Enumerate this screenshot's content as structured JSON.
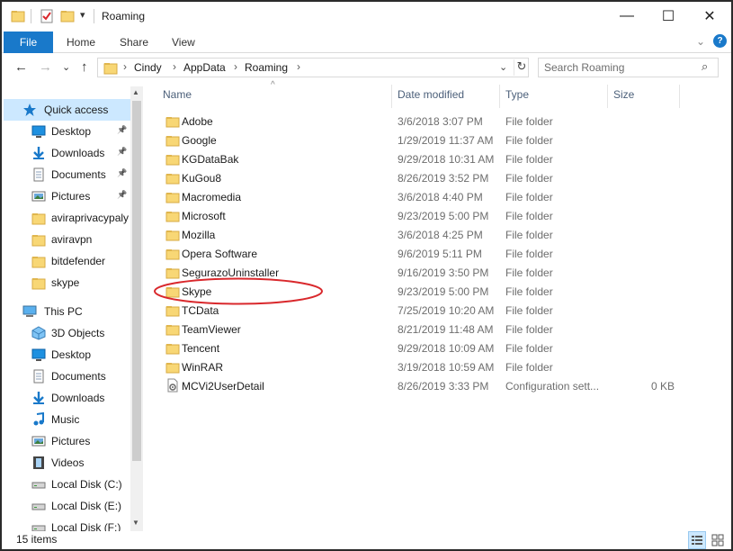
{
  "window": {
    "title": "Roaming",
    "minimize": "—",
    "maximize": "☐",
    "close": "✕"
  },
  "ribbon": {
    "tabs": [
      "File",
      "Home",
      "Share",
      "View"
    ],
    "expand_glyph": "⌄",
    "help_glyph": "?"
  },
  "nav": {
    "back": "←",
    "forward": "→",
    "recent": "⌄",
    "up": "↑",
    "breadcrumb": [
      "Cindy",
      "AppData",
      "Roaming"
    ],
    "search_placeholder": "Search Roaming"
  },
  "sidebar": {
    "items": [
      {
        "label": "Quick access",
        "icon": "star-icon",
        "pinned": false,
        "selected": true
      },
      {
        "label": "Desktop",
        "icon": "desktop-icon",
        "pinned": true
      },
      {
        "label": "Downloads",
        "icon": "download-arrow-icon",
        "pinned": true
      },
      {
        "label": "Documents",
        "icon": "document-icon",
        "pinned": true
      },
      {
        "label": "Pictures",
        "icon": "picture-icon",
        "pinned": true
      },
      {
        "label": "aviraprivacypaly",
        "icon": "folder-icon",
        "pinned": false
      },
      {
        "label": "aviravpn",
        "icon": "folder-icon",
        "pinned": false
      },
      {
        "label": "bitdefender",
        "icon": "folder-icon",
        "pinned": false
      },
      {
        "label": "skype",
        "icon": "folder-icon",
        "pinned": false
      },
      {
        "label": "This PC",
        "icon": "computer-icon",
        "pinned": false
      },
      {
        "label": "3D Objects",
        "icon": "cube-icon",
        "pinned": false
      },
      {
        "label": "Desktop",
        "icon": "desktop-icon",
        "pinned": false
      },
      {
        "label": "Documents",
        "icon": "document-icon",
        "pinned": false
      },
      {
        "label": "Downloads",
        "icon": "download-arrow-icon",
        "pinned": false
      },
      {
        "label": "Music",
        "icon": "music-note-icon",
        "pinned": false
      },
      {
        "label": "Pictures",
        "icon": "picture-icon",
        "pinned": false
      },
      {
        "label": "Videos",
        "icon": "film-icon",
        "pinned": false
      },
      {
        "label": "Local Disk (C:)",
        "icon": "drive-icon",
        "pinned": false
      },
      {
        "label": "Local Disk (E:)",
        "icon": "drive-icon",
        "pinned": false
      },
      {
        "label": "Local Disk (F:)",
        "icon": "drive-icon",
        "pinned": false
      }
    ]
  },
  "columns": {
    "name": "Name",
    "date": "Date modified",
    "type": "Type",
    "size": "Size"
  },
  "files": [
    {
      "name": "Adobe",
      "date": "3/6/2018 3:07 PM",
      "type": "File folder",
      "size": ""
    },
    {
      "name": "Google",
      "date": "1/29/2019 11:37 AM",
      "type": "File folder",
      "size": ""
    },
    {
      "name": "KGDataBak",
      "date": "9/29/2018 10:31 AM",
      "type": "File folder",
      "size": ""
    },
    {
      "name": "KuGou8",
      "date": "8/26/2019 3:52 PM",
      "type": "File folder",
      "size": ""
    },
    {
      "name": "Macromedia",
      "date": "3/6/2018 4:40 PM",
      "type": "File folder",
      "size": ""
    },
    {
      "name": "Microsoft",
      "date": "9/23/2019 5:00 PM",
      "type": "File folder",
      "size": ""
    },
    {
      "name": "Mozilla",
      "date": "3/6/2018 4:25 PM",
      "type": "File folder",
      "size": ""
    },
    {
      "name": "Opera Software",
      "date": "9/6/2019 5:11 PM",
      "type": "File folder",
      "size": ""
    },
    {
      "name": "SegurazoUninstaller",
      "date": "9/16/2019 3:50 PM",
      "type": "File folder",
      "size": ""
    },
    {
      "name": "Skype",
      "date": "9/23/2019 5:00 PM",
      "type": "File folder",
      "size": ""
    },
    {
      "name": "TCData",
      "date": "7/25/2019 10:20 AM",
      "type": "File folder",
      "size": ""
    },
    {
      "name": "TeamViewer",
      "date": "8/21/2019 11:48 AM",
      "type": "File folder",
      "size": ""
    },
    {
      "name": "Tencent",
      "date": "9/29/2018 10:09 AM",
      "type": "File folder",
      "size": ""
    },
    {
      "name": "WinRAR",
      "date": "3/19/2018 10:59 AM",
      "type": "File folder",
      "size": ""
    },
    {
      "name": "MCVi2UserDetail",
      "date": "8/26/2019 3:33 PM",
      "type": "Configuration sett...",
      "size": "0 KB"
    }
  ],
  "status": {
    "count": "15 items"
  },
  "colors": {
    "accent": "#1979ca",
    "selection": "#cce8ff",
    "annotation": "#d9282c"
  }
}
